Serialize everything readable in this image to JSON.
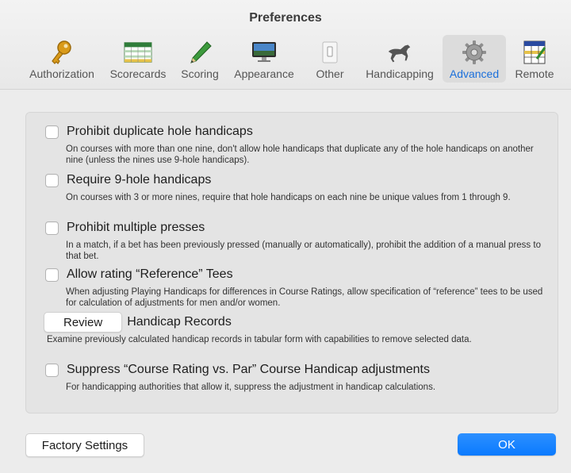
{
  "window": {
    "title": "Preferences"
  },
  "tabs": [
    {
      "label": "Authorization",
      "icon": "key-icon"
    },
    {
      "label": "Scorecards",
      "icon": "scorecard-icon"
    },
    {
      "label": "Scoring",
      "icon": "pencil-icon"
    },
    {
      "label": "Appearance",
      "icon": "monitor-icon"
    },
    {
      "label": "Other",
      "icon": "switch-icon"
    },
    {
      "label": "Handicapping",
      "icon": "horse-icon"
    },
    {
      "label": "Advanced",
      "icon": "gear-icon",
      "selected": true
    },
    {
      "label": "Remote",
      "icon": "scorepad-icon"
    }
  ],
  "options": [
    {
      "label": "Prohibit duplicate hole handicaps",
      "checked": false,
      "desc": "On courses with more than one nine, don't allow hole handicaps that duplicate any of the hole handicaps on another nine (unless the nines use 9-hole handicaps)."
    },
    {
      "label": "Require 9-hole handicaps",
      "checked": false,
      "desc": "On courses with 3 or more nines, require that hole handicaps on each nine be unique values from 1 through 9."
    },
    {
      "label": "Prohibit multiple presses",
      "checked": false,
      "desc": "In a match, if a bet has been previously pressed (manually or automatically), prohibit the addition of a manual press to that bet."
    },
    {
      "label": "Allow rating “Reference” Tees",
      "checked": false,
      "desc": "When adjusting Playing Handicaps for differences in Course Ratings, allow specification of “reference” tees to be used for calculation of adjustments for men and/or women."
    },
    {
      "label": "Suppress “Course Rating vs. Par” Course Handicap adjustments",
      "checked": false,
      "desc": "For handicapping authorities that allow it, suppress the adjustment in handicap calculations."
    }
  ],
  "review": {
    "button": "Review",
    "label": "Handicap Records",
    "desc": "Examine previously calculated handicap records in tabular form with capabilities to remove selected data."
  },
  "footer": {
    "factory": "Factory Settings",
    "ok": "OK"
  },
  "colors": {
    "accent": "#0a7aff",
    "selected_tab_label": "#1a6fdb"
  }
}
